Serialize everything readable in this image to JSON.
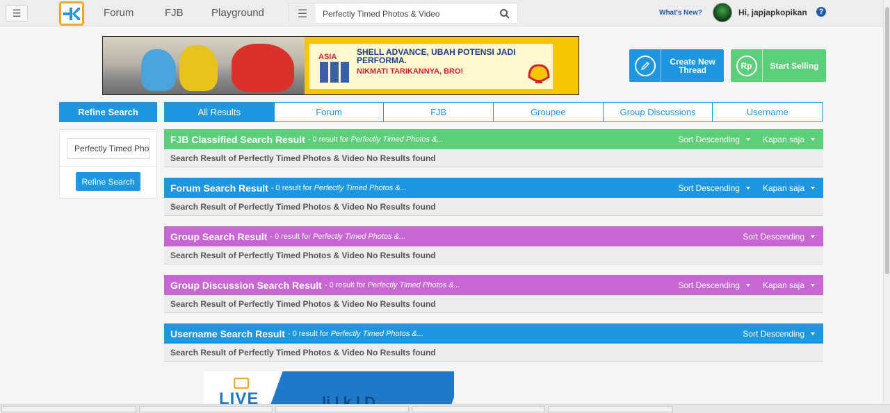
{
  "nav": {
    "links": [
      "Forum",
      "FJB",
      "Playground"
    ],
    "search_value": "Perfectly Timed Photos & Video",
    "whats_new": "What's New?",
    "greeting": "Hi, japjapkopikan",
    "help": "?"
  },
  "banner": {
    "asia_label": "ASIA",
    "headline": "SHELL ADVANCE, UBAH POTENSI JADI PERFORMA.",
    "subline": "NIKMATI TARIKANNYA, BRO!"
  },
  "cta": {
    "thread": "Create New Thread",
    "sell": "Start Selling",
    "sell_icon": "Rp"
  },
  "refine": {
    "title": "Refine Search",
    "input_value": "Perfectly Timed Photos & Video",
    "button": "Refine Search"
  },
  "tabs": [
    "All Results",
    "Forum",
    "FJB",
    "Groupee",
    "Group Discussions",
    "Username"
  ],
  "sections": [
    {
      "title": "FJB Classified Search Result",
      "meta_prefix": " - 0 result for ",
      "meta_query": "Perfectly Timed Photos &...",
      "sort": "Sort Descending",
      "time": "Kapan saja",
      "body": "Search Result of Perfectly Timed Photos & Video No Results found",
      "color": "#5ccf7a"
    },
    {
      "title": "Forum Search Result",
      "meta_prefix": " - 0 result for ",
      "meta_query": "Perfectly Timed Photos &...",
      "sort": "Sort Descending",
      "time": "Kapan saja",
      "body": "Search Result of Perfectly Timed Photos & Video No Results found",
      "color": "#1e96e0"
    },
    {
      "title": "Group Search Result",
      "meta_prefix": " - 0 result for ",
      "meta_query": "Perfectly Timed Photos &...",
      "sort": "Sort Descending",
      "time": "",
      "body": "Search Result of Perfectly Timed Photos & Video No Results found",
      "color": "#c766d3"
    },
    {
      "title": "Group Discussion Search Result",
      "meta_prefix": " - 0 result for ",
      "meta_query": "Perfectly Timed Photos &...",
      "sort": "Sort Descending",
      "time": "Kapan saja",
      "body": "Search Result of Perfectly Timed Photos & Video No Results found",
      "color": "#c766d3"
    },
    {
      "title": "Username Search Result",
      "meta_prefix": " - 0 result for ",
      "meta_query": "Perfectly Timed Photos &...",
      "sort": "Sort Descending",
      "time": "",
      "body": "Search Result of Perfectly Timed Photos & Video No Results found",
      "color": "#1e96e0"
    }
  ],
  "live": {
    "word": "LIVE",
    "blue_text": "li l k  l  D"
  },
  "icons": {
    "menu": "hamburger-icon",
    "logo": "kaskus-logo-icon",
    "search": "search-icon",
    "pencil": "pencil-icon",
    "rupiah": "rupiah-icon"
  }
}
